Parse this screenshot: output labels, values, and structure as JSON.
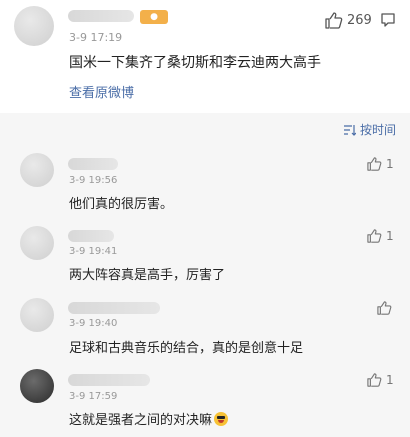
{
  "main_comment": {
    "time": "3-9 17:19",
    "text": "国米一下集齐了桑切斯和李云迪两大高手",
    "like_count": "269",
    "view_weibo": "查看原微博"
  },
  "sort_label": "按时间",
  "replies": [
    {
      "time": "3-9 19:56",
      "text": "他们真的很厉害。",
      "likes": "1"
    },
    {
      "time": "3-9 19:41",
      "text": "两大阵容真是高手，厉害了",
      "likes": "1"
    },
    {
      "time": "3-9 19:40",
      "text": "足球和古典音乐的结合，真的是创意十足",
      "likes": ""
    },
    {
      "time": "3-9 17:59",
      "text": "这就是强者之间的对决嘛",
      "likes": "1"
    }
  ],
  "icons": {
    "like": "thumbs-up-icon",
    "more": "message-icon",
    "sort": "sort-icon",
    "emoji": "laughing-emoji-icon"
  },
  "colors": {
    "link": "#4a6da7",
    "background": "#f6f6f6",
    "badge": "#f3b04a"
  }
}
